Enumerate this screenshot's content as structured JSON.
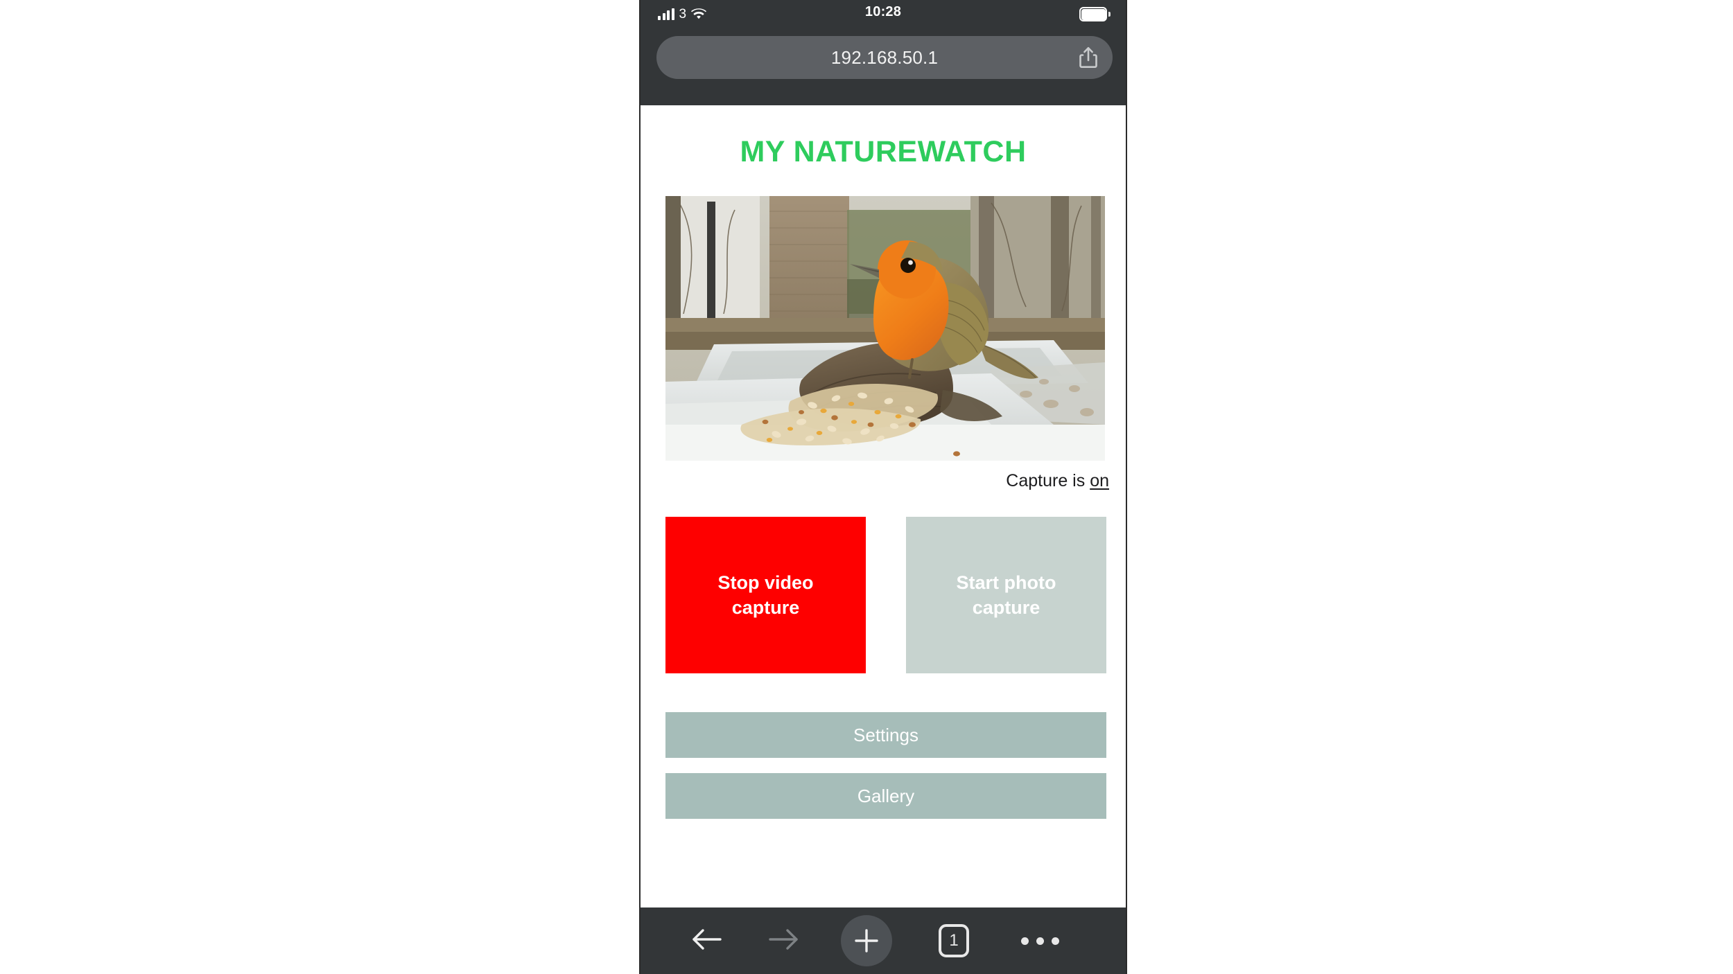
{
  "phone": {
    "status_bar": {
      "carrier": "3",
      "time": "10:28",
      "signal_icon": "cellular-signal-icon",
      "wifi_icon": "wifi-icon",
      "battery_icon": "battery-full-icon"
    },
    "address_bar": {
      "url": "192.168.50.1",
      "share_icon": "share-icon"
    },
    "bottom_toolbar": {
      "back_icon": "arrow-left-icon",
      "forward_icon": "arrow-right-icon",
      "new_tab_icon": "plus-icon",
      "tab_count": "1",
      "more_icon": "ellipsis-icon"
    }
  },
  "page": {
    "title": "MY NATUREWATCH",
    "preview_alt": "live-camera-preview-robin-on-feeder",
    "capture_status_label": "Capture is ",
    "capture_status_value": "on",
    "buttons": {
      "video": "Stop video capture",
      "photo": "Start photo capture",
      "settings": "Settings",
      "gallery": "Gallery"
    }
  },
  "colors": {
    "brand_green": "#2ecc5d",
    "stop_red": "#fe0000",
    "muted_button": "#c7d3cf",
    "wide_button": "#a6bdb9",
    "chrome_dark": "#333638",
    "address_pill": "#5d6064"
  }
}
